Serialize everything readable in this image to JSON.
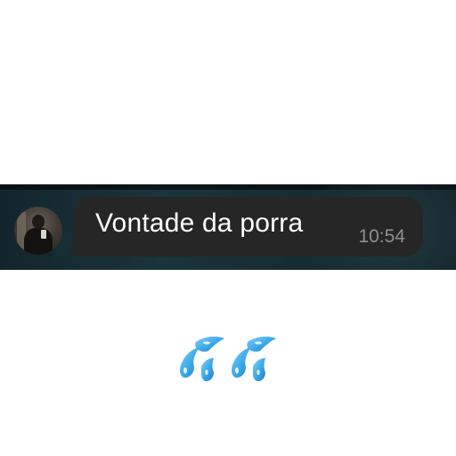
{
  "message": {
    "text": "Vontade da porra",
    "time": "10:54"
  },
  "avatar": {
    "icon": "profile-photo"
  },
  "reaction": {
    "icon": "sweat-droplets-icon",
    "count": 2
  },
  "colors": {
    "bubble": "#262626",
    "text": "#ffffff",
    "time": "#8e8e8e",
    "droplet": "#3ba7e6"
  }
}
